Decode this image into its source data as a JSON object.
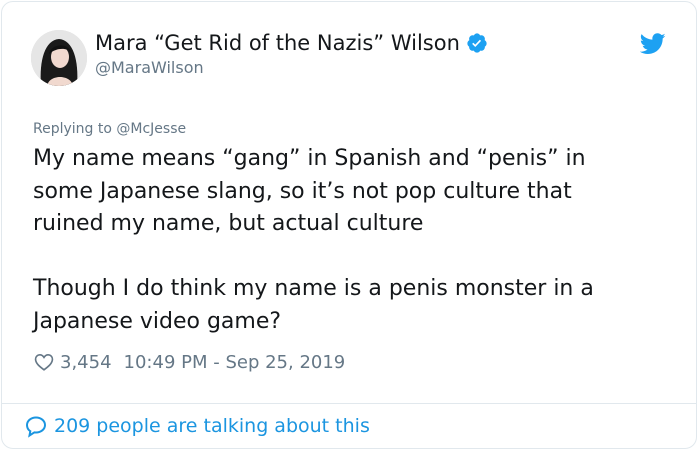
{
  "tweet": {
    "display_name": "Mara “Get Rid of the Nazis” Wilson",
    "handle": "@MaraWilson",
    "replying_prefix": "Replying to ",
    "replying_to": "@McJesse",
    "text": "My name means “gang” in Spanish and “penis” in\nsome Japanese slang, so it’s not pop culture that\nruined my name, but actual culture\n\nThough I do think my name is a penis monster in a\nJapanese video game?",
    "likes": "3,454",
    "timestamp": "10:49 PM - Sep 25, 2019",
    "talking": "209 people are talking about this"
  },
  "icons": {
    "verified": "verified-badge-icon",
    "bird": "twitter-bird-icon",
    "heart": "heart-icon",
    "comment": "speech-bubble-icon"
  },
  "colors": {
    "accent": "#1da1f2",
    "link": "#1b95e0",
    "secondary_text": "#657786",
    "border": "#e1e8ed"
  }
}
